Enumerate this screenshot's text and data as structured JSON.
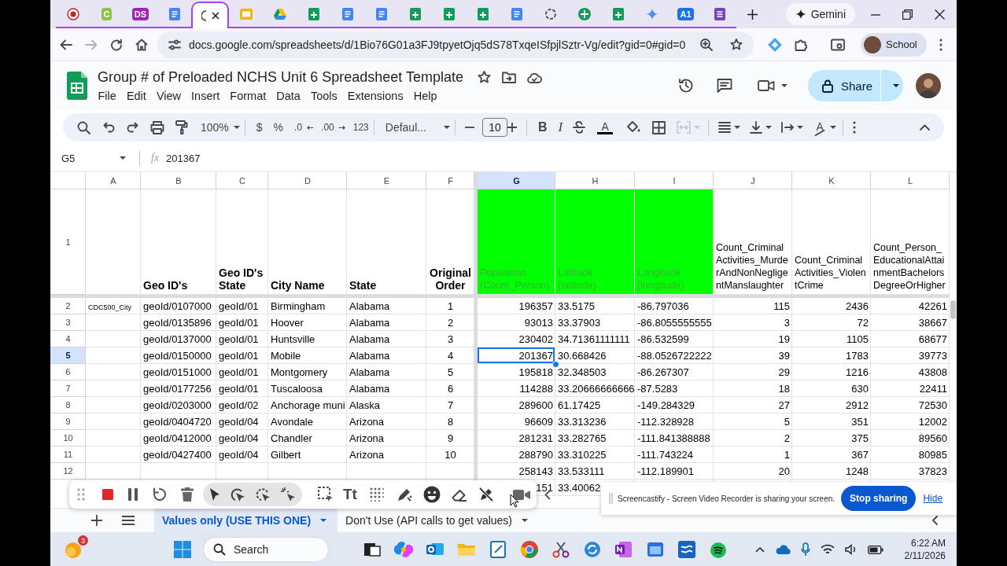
{
  "browser": {
    "tabs": [
      {
        "kind": "record",
        "selected": false
      },
      {
        "kind": "letter",
        "text": "C",
        "color": "#8bc34a",
        "selected": false
      },
      {
        "kind": "letter",
        "text": "DS",
        "color": "#9c27b0",
        "selected": false
      },
      {
        "kind": "docs",
        "selected": false
      },
      {
        "kind": "loading",
        "selected": true
      },
      {
        "kind": "slides",
        "selected": false
      },
      {
        "kind": "drive",
        "selected": false
      },
      {
        "kind": "sheets",
        "selected": false
      },
      {
        "kind": "docs",
        "selected": false
      },
      {
        "kind": "docs",
        "selected": false
      },
      {
        "kind": "sheets",
        "selected": false
      },
      {
        "kind": "sheets",
        "selected": false
      },
      {
        "kind": "sheets",
        "selected": false
      },
      {
        "kind": "docs",
        "selected": false
      },
      {
        "kind": "knot",
        "selected": false
      },
      {
        "kind": "circle",
        "selected": false
      },
      {
        "kind": "sheets",
        "selected": false
      },
      {
        "kind": "gemini",
        "selected": false
      },
      {
        "kind": "letter",
        "text": "A1",
        "color": "#1a73e8",
        "selected": false
      },
      {
        "kind": "forms",
        "selected": false
      }
    ],
    "gemini": "Gemini",
    "url": "docs.google.com/spreadsheets/d/1Bio76G01a3FJ9tpyetOjq5dS78TxqeISfpjlSztr-Vg/edit?gid=0#gid=0",
    "profile": "School"
  },
  "document": {
    "title": "Group # of Preloaded NCHS Unit 6 Spreadsheet Template",
    "menu": [
      "File",
      "Edit",
      "View",
      "Insert",
      "Format",
      "Data",
      "Tools",
      "Extensions",
      "Help"
    ],
    "share": "Share"
  },
  "toolbar": {
    "zoom": "100%",
    "currency": "$",
    "percent": "%",
    "decrease_decimals": ".0",
    "increase_decimals": ".00",
    "number_format": "123",
    "font": "Defaul...",
    "font_size": "10",
    "bold": "B",
    "italic": "I",
    "text_color": "A",
    "text_rotation": "A"
  },
  "formula_bar": {
    "cell": "G5",
    "fx": "fx",
    "value": "201367"
  },
  "sheet": {
    "columns": [
      {
        "label": "A",
        "kind": "text",
        "selected": false
      },
      {
        "label": "B",
        "kind": "text",
        "selected": false
      },
      {
        "label": "C",
        "kind": "text",
        "selected": false
      },
      {
        "label": "D",
        "kind": "text",
        "selected": false
      },
      {
        "label": "E",
        "kind": "text",
        "selected": false
      },
      {
        "label": "F",
        "kind": "order",
        "selected": false
      },
      {
        "label": "G",
        "kind": "number",
        "selected": true
      },
      {
        "label": "H",
        "kind": "text",
        "selected": false
      },
      {
        "label": "I",
        "kind": "text",
        "selected": false
      },
      {
        "label": "J",
        "kind": "number",
        "selected": false
      },
      {
        "label": "K",
        "kind": "number",
        "selected": false
      },
      {
        "label": "L",
        "kind": "number",
        "selected": false
      }
    ],
    "header_row": {
      "number": "1",
      "cells": [
        null,
        {
          "text": "Geo ID's",
          "bold": true
        },
        {
          "text": "Geo ID's State",
          "bold": true
        },
        {
          "text": "City Name",
          "bold": true
        },
        {
          "text": "State",
          "bold": true
        },
        {
          "text": "Original Order",
          "bold": true
        },
        {
          "text": "Population (Count_Person)",
          "bold": false,
          "color": "#00ff00"
        },
        {
          "text": "Latitude (latitude)",
          "bold": false,
          "color": "#00ff00"
        },
        {
          "text": "Longitude (longitude)",
          "bold": false,
          "color": "#00ff00"
        },
        {
          "text": "Count_CriminalActivities_MurderAndNonNegligentManslaughter",
          "bold": false
        },
        {
          "text": "Count_CriminalActivities_ViolentCrime",
          "bold": false
        },
        {
          "text": "Count_Person_EducationalAttainmentBachelorsDegreeOrHigher",
          "bold": false
        }
      ]
    },
    "rows": [
      {
        "number": "2",
        "selected": false,
        "cells": [
          {
            "text": "CDC500_City",
            "kind": "small"
          },
          "geoId/0107000",
          "geoId/01",
          "Birmingham",
          "Alabama",
          "1",
          "196357",
          "33.5175",
          "-86.797036",
          "115",
          "2436",
          "42261"
        ]
      },
      {
        "number": "3",
        "selected": false,
        "cells": [
          null,
          "geoId/0135896",
          "geoId/01",
          "Hoover",
          "Alabama",
          "2",
          "93013",
          "33.37903",
          "-86.8055555555",
          "3",
          "72",
          "38667"
        ]
      },
      {
        "number": "4",
        "selected": false,
        "cells": [
          null,
          "geoId/0137000",
          "geoId/01",
          "Huntsville",
          "Alabama",
          "3",
          "230402",
          "34.71361111111",
          "-86.532599",
          "19",
          "1105",
          "68677"
        ]
      },
      {
        "number": "5",
        "selected": true,
        "cells": [
          null,
          "geoId/0150000",
          "geoId/01",
          "Mobile",
          "Alabama",
          "4",
          "201367",
          "30.668426",
          "-88.0526722222",
          "39",
          "1783",
          "39773"
        ]
      },
      {
        "number": "6",
        "selected": false,
        "cells": [
          null,
          "geoId/0151000",
          "geoId/01",
          "Montgomery",
          "Alabama",
          "5",
          "195818",
          "32.348503",
          "-86.267307",
          "29",
          "1216",
          "43808"
        ]
      },
      {
        "number": "7",
        "selected": false,
        "cells": [
          null,
          "geoId/0177256",
          "geoId/01",
          "Tuscaloosa",
          "Alabama",
          "6",
          "114288",
          "33.20666666666",
          "-87.5283",
          "18",
          "630",
          "22411"
        ]
      },
      {
        "number": "8",
        "selected": false,
        "cells": [
          null,
          "geoId/0203000",
          "geoId/02",
          "Anchorage muni",
          "Alaska",
          "7",
          "289600",
          "61.17425",
          "-149.284329",
          "27",
          "2912",
          "72530"
        ]
      },
      {
        "number": "9",
        "selected": false,
        "cells": [
          null,
          "geoId/0404720",
          "geoId/04",
          "Avondale",
          "Arizona",
          "8",
          "96609",
          "33.313236",
          "-112.328928",
          "5",
          "351",
          "12002"
        ]
      },
      {
        "number": "10",
        "selected": false,
        "cells": [
          null,
          "geoId/0412000",
          "geoId/04",
          "Chandler",
          "Arizona",
          "9",
          "281231",
          "33.282765",
          "-111.841388888",
          "2",
          "375",
          "89560"
        ]
      },
      {
        "number": "11",
        "selected": false,
        "cells": [
          null,
          "geoId/0427400",
          "geoId/04",
          "Gilbert",
          "Arizona",
          "10",
          "288790",
          "33.310225",
          "-111.743224",
          "1",
          "367",
          "80985"
        ]
      },
      {
        "number": "12",
        "selected": false,
        "cells": [
          null,
          null,
          null,
          null,
          null,
          null,
          "258143",
          "33.533111",
          "-112.189901",
          "20",
          "1248",
          "37823"
        ]
      },
      {
        "cells": [
          null,
          null,
          null,
          null,
          null,
          null,
          "151",
          "33.40062",
          null,
          null,
          null,
          null
        ]
      }
    ]
  },
  "recorder": {
    "text_tool": "Tt"
  },
  "share_banner": {
    "message": "Screencastify - Screen Video Recorder is sharing your screen.",
    "stop": "Stop sharing",
    "hide": "Hide"
  },
  "sheet_tabs": [
    {
      "label": "Values only (USE THIS ONE)",
      "selected": true
    },
    {
      "label": "Don't Use (API calls to get values)",
      "selected": false
    }
  ],
  "taskbar": {
    "weather_badge": "3",
    "search": "Search",
    "time": "6:22 AM",
    "date": "2/11/2026"
  }
}
